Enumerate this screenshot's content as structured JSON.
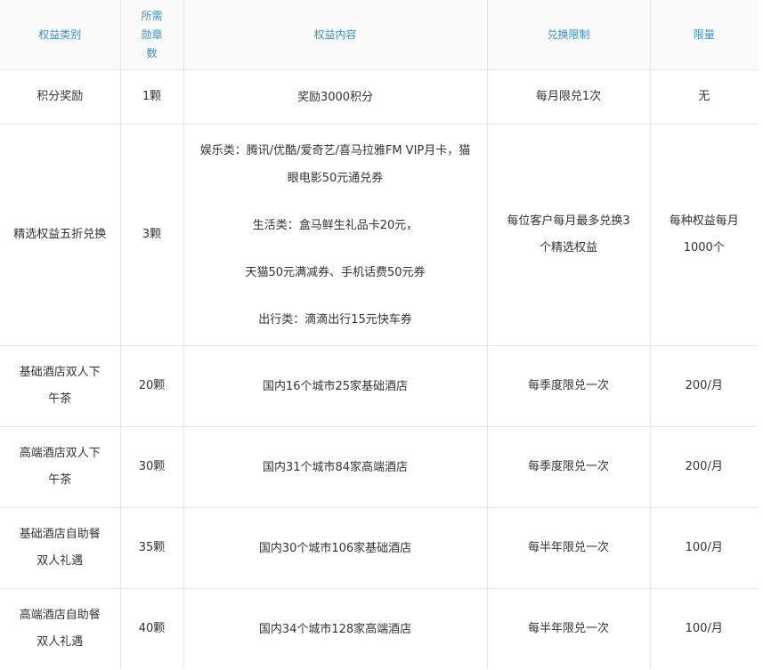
{
  "headers": {
    "category": "权益类别",
    "badges": "所需勋章数",
    "content": "权益内容",
    "limit_rule": "兑换限制",
    "quota": "限量"
  },
  "rows": [
    {
      "category": "积分奖励",
      "badges": "1颗",
      "content": [
        "奖励3000积分"
      ],
      "limit_rule": "每月限兑1次",
      "quota": "无"
    },
    {
      "category": "精选权益五折兑换",
      "badges": "3颗",
      "content": [
        "娱乐类：腾讯/优酷/爱奇艺/喜马拉雅FM VIP月卡，猫眼电影50元通兑券",
        "生活类：盒马鲜生礼品卡20元，",
        "天猫50元满减券、手机话费50元券",
        "出行类：滴滴出行15元快车券"
      ],
      "limit_rule": "每位客户每月最多兑换3个精选权益",
      "quota": "每种权益每月1000个"
    },
    {
      "category": "基础酒店双人下午茶",
      "badges": "20颗",
      "content": [
        "国内16个城市25家基础酒店"
      ],
      "limit_rule": "每季度限兑一次",
      "quota": "200/月"
    },
    {
      "category": "高端酒店双人下午茶",
      "badges": "30颗",
      "content": [
        "国内31个城市84家高端酒店"
      ],
      "limit_rule": "每季度限兑一次",
      "quota": "200/月"
    },
    {
      "category": "基础酒店自助餐双人礼遇",
      "badges": "35颗",
      "content": [
        "国内30个城市106家基础酒店"
      ],
      "limit_rule": "每半年限兑一次",
      "quota": "100/月"
    },
    {
      "category": "高端酒店自助餐双人礼遇",
      "badges": "40颗",
      "content": [
        "国内34个城市128家高端酒店"
      ],
      "limit_rule": "每半年限兑一次",
      "quota": "100/月"
    }
  ]
}
